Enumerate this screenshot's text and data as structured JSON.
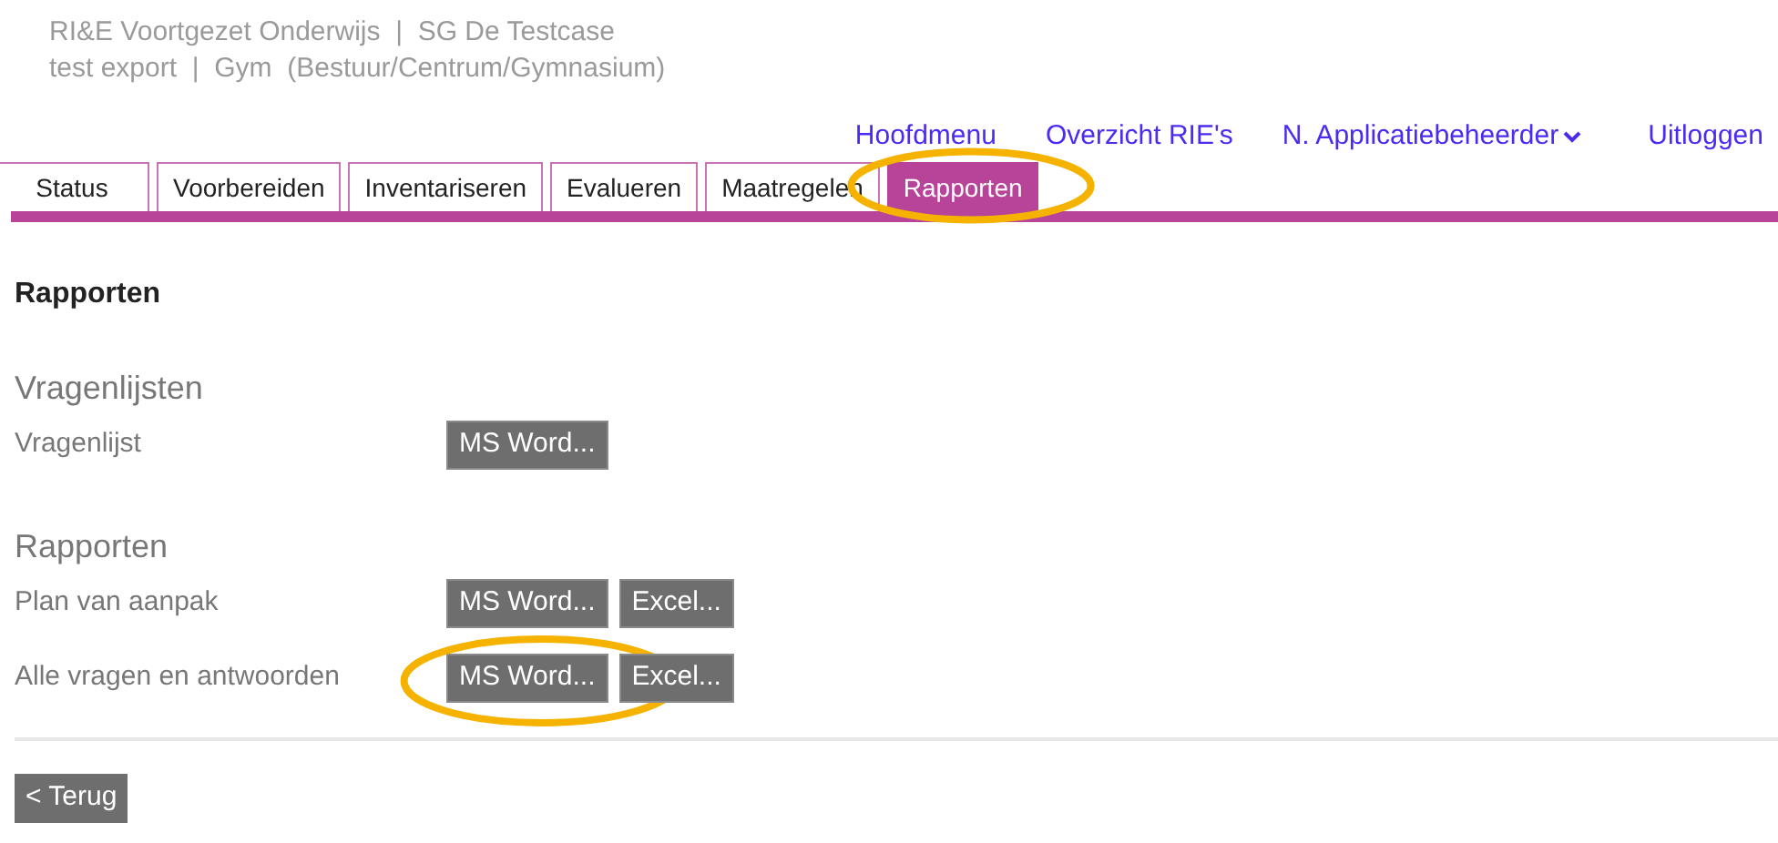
{
  "header": {
    "line_1": "RI&E Voortgezet Onderwijs  |  SG De Testcase",
    "line_2": "test export  |  Gym  (Bestuur/Centrum/Gymnasium)"
  },
  "nav": [
    {
      "label": "Hoofdmenu",
      "dropdown": false
    },
    {
      "label": "Overzicht RIE's",
      "dropdown": false
    },
    {
      "label": "N. Applicatiebeheerder",
      "dropdown": true
    },
    {
      "label": "Uitloggen",
      "dropdown": false
    }
  ],
  "tabs": [
    {
      "label": "Status",
      "selected": false,
      "highlighted": false
    },
    {
      "label": "Voorbereiden",
      "selected": false,
      "highlighted": false
    },
    {
      "label": "Inventariseren",
      "selected": false,
      "highlighted": false
    },
    {
      "label": "Evalueren",
      "selected": false,
      "highlighted": false
    },
    {
      "label": "Maatregelen",
      "selected": false,
      "highlighted": false
    },
    {
      "label": "Rapporten",
      "selected": true,
      "highlighted": true
    }
  ],
  "page_title": "Rapporten",
  "sections": [
    {
      "title": "Vragenlijsten",
      "rows": [
        {
          "label": "Vragenlijst",
          "buttons": [
            {
              "label": "MS Word...",
              "highlighted": false
            }
          ]
        }
      ]
    },
    {
      "title": "Rapporten",
      "rows": [
        {
          "label": "Plan van aanpak",
          "buttons": [
            {
              "label": "MS Word...",
              "highlighted": false
            },
            {
              "label": "Excel...",
              "highlighted": false
            }
          ]
        },
        {
          "label": "Alle vragen en antwoorden",
          "buttons": [
            {
              "label": "MS Word...",
              "highlighted": true
            },
            {
              "label": "Excel...",
              "highlighted": false
            }
          ]
        }
      ]
    }
  ],
  "back_button": "< Terug"
}
